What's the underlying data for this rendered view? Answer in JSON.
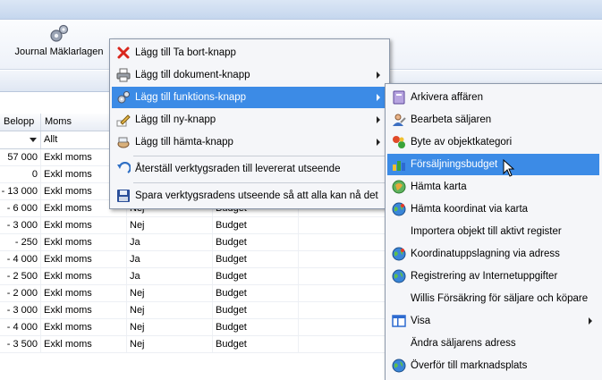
{
  "toolbar": {
    "journal_label": "Journal Mäklarlagen"
  },
  "grid": {
    "headers": {
      "belopp": "Belopp",
      "moms": "Moms"
    },
    "filter": {
      "moms": "Allt"
    },
    "rows": [
      {
        "belopp": "57 000",
        "moms": "Exkl moms",
        "x": "",
        "y": ""
      },
      {
        "belopp": "0",
        "moms": "Exkl moms",
        "x": "",
        "y": ""
      },
      {
        "belopp": "- 13 000",
        "moms": "Exkl moms",
        "x": "",
        "y": ""
      },
      {
        "belopp": "- 6 000",
        "moms": "Exkl moms",
        "x": "Nej",
        "y": "Budget"
      },
      {
        "belopp": "- 3 000",
        "moms": "Exkl moms",
        "x": "Nej",
        "y": "Budget"
      },
      {
        "belopp": "- 250",
        "moms": "Exkl moms",
        "x": "Ja",
        "y": "Budget"
      },
      {
        "belopp": "- 4 000",
        "moms": "Exkl moms",
        "x": "Ja",
        "y": "Budget"
      },
      {
        "belopp": "- 2 500",
        "moms": "Exkl moms",
        "x": "Ja",
        "y": "Budget"
      },
      {
        "belopp": "- 2 000",
        "moms": "Exkl moms",
        "x": "Nej",
        "y": "Budget"
      },
      {
        "belopp": "- 3 000",
        "moms": "Exkl moms",
        "x": "Nej",
        "y": "Budget"
      },
      {
        "belopp": "- 4 000",
        "moms": "Exkl moms",
        "x": "Nej",
        "y": "Budget"
      },
      {
        "belopp": "- 3 500",
        "moms": "Exkl moms",
        "x": "Nej",
        "y": "Budget"
      }
    ]
  },
  "main_menu": {
    "items": [
      {
        "label": "Lägg till Ta bort-knapp",
        "icon": "red-x-icon"
      },
      {
        "label": "Lägg till dokument-knapp",
        "icon": "printer-icon",
        "submenu": true
      },
      {
        "label": "Lägg till funktions-knapp",
        "icon": "gears-icon",
        "submenu": true,
        "highlighted": true
      },
      {
        "label": "Lägg till ny-knapp",
        "icon": "pencil-icon",
        "submenu": true
      },
      {
        "label": "Lägg till hämta-knapp",
        "icon": "hand-icon",
        "submenu": true
      },
      {
        "label": "Återställ verktygsraden till levererat utseende",
        "icon": "undo-arrow-icon"
      },
      {
        "label": "Spara verktygsradens utseende så att alla kan nå det",
        "icon": "floppy-disk-icon"
      }
    ]
  },
  "sub_menu": {
    "items": [
      {
        "label": "Arkivera affären",
        "icon": "archive-icon"
      },
      {
        "label": "Bearbeta säljaren",
        "icon": "person-icon"
      },
      {
        "label": "Byte av objektkategori",
        "icon": "swap-icon"
      },
      {
        "label": "Försäljningsbudget",
        "icon": "budget-icon",
        "highlighted": true
      },
      {
        "label": "Hämta karta",
        "icon": "map-icon"
      },
      {
        "label": "Hämta koordinat via karta",
        "icon": "globe-icon"
      },
      {
        "label": "Importera objekt till aktivt register",
        "icon": ""
      },
      {
        "label": "Koordinatuppslagning via adress",
        "icon": "globe-icon"
      },
      {
        "label": "Registrering av Internetuppgifter",
        "icon": "globe-icon"
      },
      {
        "label": "Willis Försäkring för säljare och köpare",
        "icon": ""
      },
      {
        "label": "Visa",
        "icon": "window-icon",
        "submenu": true
      },
      {
        "label": "Ändra säljarens adress",
        "icon": ""
      },
      {
        "label": "Överför till marknadsplats",
        "icon": "globe-icon"
      }
    ]
  },
  "colors": {
    "highlight": "#3c8be6",
    "menu_bg": "#f5f6f9"
  }
}
